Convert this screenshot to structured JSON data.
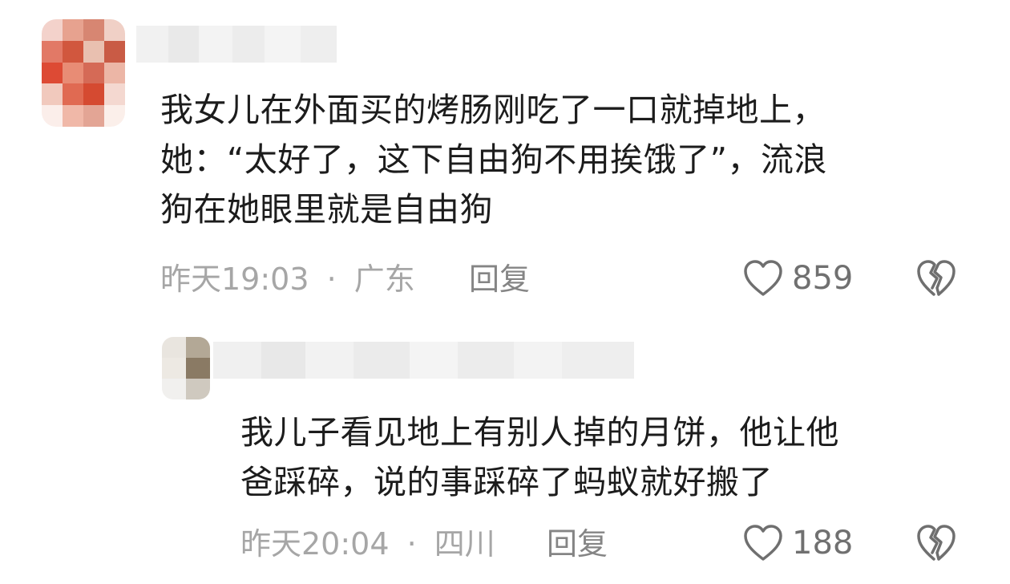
{
  "comments": [
    {
      "text_lines": [
        "我女儿在外面买的烤肠刚吃了一口就掉地上，",
        "她：“太好了，这下自由狗不用挨饿了”，流浪",
        "狗在她眼里就是自由狗"
      ],
      "time": "昨天19:03",
      "separator": "·",
      "location": "广东",
      "reply_label": "回复",
      "likes": "859",
      "like_icon": "heart-outline-icon",
      "dislike_icon": "broken-heart-icon"
    },
    {
      "text_lines": [
        "我儿子看见地上有别人掉的月饼，他让他",
        "爸踩碎，说的事踩碎了蚂蚁就好搬了"
      ],
      "time": "昨天20:04",
      "separator": "·",
      "location": "四川",
      "reply_label": "回复",
      "likes": "188",
      "like_icon": "heart-outline-icon",
      "dislike_icon": "broken-heart-icon"
    }
  ]
}
